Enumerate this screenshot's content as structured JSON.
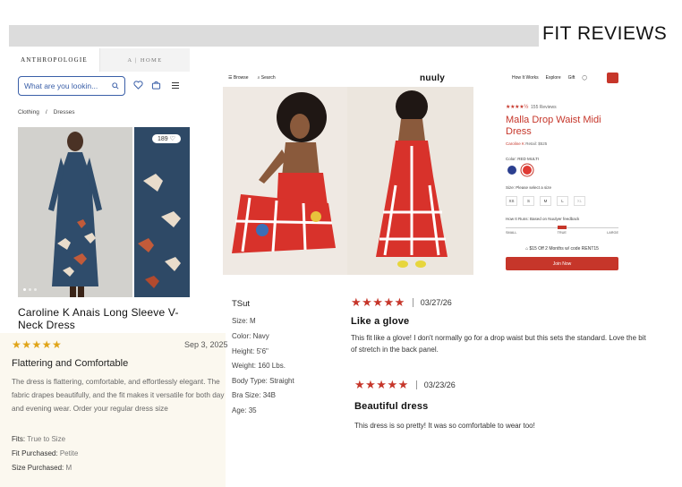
{
  "header": {
    "title": "FIT REVIEWS"
  },
  "anthropologie": {
    "tabs": [
      "ANTHROPOLOGIE",
      "A | HOME"
    ],
    "search_placeholder": "What are you lookin...",
    "breadcrumb": [
      "Clothing",
      "/",
      "Dresses"
    ],
    "image_badge": "189 ♡",
    "product_name": "Caroline K Anais Long Sleeve V-Neck Dress",
    "review": {
      "stars": "★★★★★",
      "date": "Sep 3, 2025",
      "title": "Flattering and Comfortable",
      "body": "The dress is flattering, comfortable, and effortlessly elegant. The fabric drapes beautifully, and the fit makes it versatile for both day and evening wear. Order your regular dress size",
      "attributes": [
        {
          "label": "Fits:",
          "value": "True to Size"
        },
        {
          "label": "Fit Purchased:",
          "value": "Petite"
        },
        {
          "label": "Size Purchased:",
          "value": "M"
        }
      ]
    }
  },
  "nuuly": {
    "nav": {
      "browse": "Browse",
      "search": "Search",
      "logo": "nuuly",
      "how_it_works": "How It Works",
      "explore": "Explore",
      "gift": "Gift"
    },
    "ratings_count": "155 Reviews",
    "rating_stars": "★★★★½",
    "product_title": "Malla Drop Waist Midi Dress",
    "brand": "Caroline K",
    "retail": "Retail: $525",
    "color_label": "Color: RED MULTI",
    "size_label": "Size: Please select a size",
    "sizes": [
      "XS",
      "S",
      "M",
      "L",
      "XL"
    ],
    "fit_label": "How It Runs: Based on Nuulyer feedback",
    "fit_scale": [
      "SMALL",
      "TRUE",
      "LARGE"
    ],
    "fit_value": 0.5,
    "promo": "$15 Off 2 Months w/ code RENT15",
    "join_label": "Join Now",
    "reviewer": {
      "name": "TSut",
      "specs": [
        {
          "label": "Size:",
          "value": "M"
        },
        {
          "label": "Color:",
          "value": "Navy"
        },
        {
          "label": "Height:",
          "value": "5'6\""
        },
        {
          "label": "Weight:",
          "value": "160 Lbs."
        },
        {
          "label": "Body Type:",
          "value": "Straight"
        },
        {
          "label": "Bra Size:",
          "value": "34B"
        },
        {
          "label": "Age:",
          "value": "35"
        }
      ]
    },
    "reviews": [
      {
        "stars": "★★★★★",
        "date": "03/27/26",
        "title": "Like a glove",
        "body": "This fit like a glove! I don't normally go for a drop waist but this sets the standard. Love the bit of stretch in the back panel."
      },
      {
        "stars": "★★★★★",
        "date": "03/23/26",
        "title": "Beautiful dress",
        "body": "This dress is so pretty! It was so comfortable to wear too!"
      }
    ]
  },
  "colors": {
    "nuuly_red": "#c6362a",
    "anthro_blue": "#3a5fa8",
    "star_gold": "#e0a418",
    "review_bg": "#fbf8ef"
  }
}
